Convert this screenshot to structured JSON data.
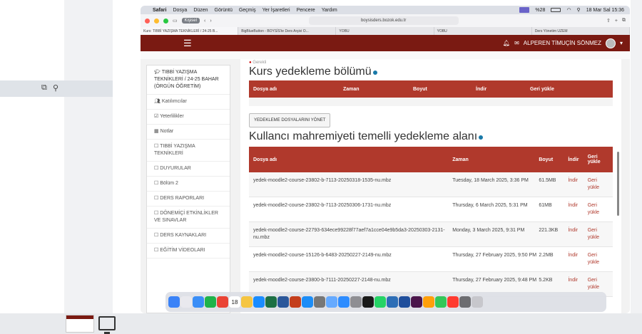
{
  "menubar": {
    "apple": "",
    "app": "Safari",
    "items": [
      "Dosya",
      "Düzen",
      "Görüntü",
      "Geçmiş",
      "Yer İşaretleri",
      "Pencere",
      "Yardım"
    ],
    "battery": "%28",
    "date": "18 Mar Sal  15:36"
  },
  "safari": {
    "profile": "Kişisel",
    "url": "boysisders.bozok.edu.tr"
  },
  "tabs": [
    "Kurs: TIBBİ YAZIŞMA TEKNİKLERİ / 24-25 B...",
    "BigBlueButton - BOYSİS'te Ders Arşivi O...",
    "YOBU",
    "YOBU",
    "Ders Yönetim UZEM"
  ],
  "moodle": {
    "hamburger": "☰",
    "user_name": "ALPEREN TİMUÇİN SÖNMEZ"
  },
  "nav": [
    "TIBBİ YAZIŞMA TEKNİKLERİ / 24-25 BAHAR (ÖRGÜN ÖĞRETİM)",
    "Katılımcılar",
    "Yeterlilikler",
    "Notlar",
    "TIBBİ YAZIŞMA TEKNİKLERİ",
    "DUYURULAR",
    "Bölüm 2",
    "DERS RAPORLARI",
    "DÖNEMİÇİ ETKİNLİKLER VE SINAVLAR",
    "DERS KAYNAKLARI",
    "EĞİTİM VİDEOLARI"
  ],
  "main": {
    "required": "Gerekli",
    "course_backup_title": "Kurs yedekleme bölümü",
    "course_table": [
      "Dosya adı",
      "Zaman",
      "Boyut",
      "İndir",
      "Geri yükle"
    ],
    "manage_button": "YEDEKLEME DOSYALARINI YÖNET",
    "user_backup_title": "Kullancı mahremiyeti temelli yedekleme alanı",
    "user_table": {
      "headers": [
        "Dosya adı",
        "Zaman",
        "Boyut",
        "İndir",
        "Geri yükle"
      ],
      "rows": [
        [
          "yedek-moodle2-course-23802-b-7113-20250318-1535-nu.mbz",
          "Tuesday, 18 March 2025, 3:36 PM",
          "61.5MB",
          "İndir",
          "Geri yükle"
        ],
        [
          "yedek-moodle2-course-23802-b-7113-20250306-1731-nu.mbz",
          "Thursday, 6 March 2025, 5:31 PM",
          "61MB",
          "İndir",
          "Geri yükle"
        ],
        [
          "yedek-moodle2-course-22793-634ece99228f77aef7a1cce04e9b5da3-20250303-2131-nu.mbz",
          "Monday, 3 March 2025, 9:31 PM",
          "221.3KB",
          "İndir",
          "Geri yükle"
        ],
        [
          "yedek-moodle2-course-15126-b-6483-20250227-2149-nu.mbz",
          "Thursday, 27 February 2025, 9:50 PM",
          "2.2MB",
          "İndir",
          "Geri yükle"
        ],
        [
          "yedek-moodle2-course-23800-b-7111-20250227-2148-nu.mbz",
          "Thursday, 27 February 2025, 9:48 PM",
          "5.2KB",
          "İndir",
          "Geri yükle"
        ]
      ]
    }
  },
  "dock": {
    "calendar_day": "18",
    "apps": [
      "finder",
      "launchpad",
      "mail",
      "facetime",
      "chrome",
      "calendar",
      "notes",
      "safari",
      "excel",
      "word",
      "powerpoint",
      "appstore",
      "keychain",
      "preview",
      "zoom",
      "settings",
      "chatgpt",
      "whatsapp",
      "files",
      "vpn",
      "slack",
      "photos",
      "messages",
      "reminders",
      "documents",
      "trash"
    ],
    "colors": [
      "#3a82f7",
      "#e9e9ee",
      "#3a8ef7",
      "#1fb34a",
      "#ea4335",
      "#ffffff",
      "#f5c542",
      "#1a8cff",
      "#1d7044",
      "#2b579a",
      "#c43e1c",
      "#1c8df7",
      "#777777",
      "#66aaff",
      "#2d8cff",
      "#8e8e93",
      "#1a1a1a",
      "#25d366",
      "#2c6db6",
      "#1f4e9c",
      "#4a154b",
      "#ff9f0a",
      "#34c759",
      "#ff3b30",
      "#6c6c70",
      "#c7c7cc"
    ]
  },
  "desktop": {
    "side_icons": [
      "copy-icon",
      "search-doc-icon"
    ]
  }
}
